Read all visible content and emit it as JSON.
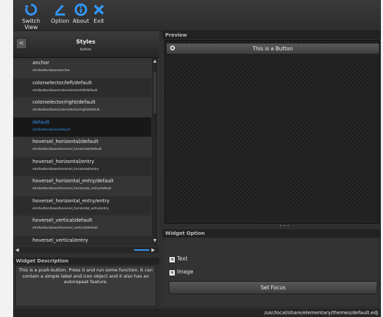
{
  "toolbar": {
    "items": [
      {
        "label": "Switch View",
        "icon": "refresh-icon"
      },
      {
        "label": "Option",
        "icon": "edit-icon"
      },
      {
        "label": "About",
        "icon": "info-icon"
      },
      {
        "label": "Exit",
        "icon": "close-icon"
      }
    ],
    "accent": "#3399ff"
  },
  "styles": {
    "back_label": "<",
    "title": "Styles",
    "subtitle": "button",
    "items": [
      {
        "name": "anchor",
        "path": "elm/button/base/anchor"
      },
      {
        "name": "colorselector/left/default",
        "path": "elm/button/base/colorselector/left/default"
      },
      {
        "name": "colorselector/right/default",
        "path": "elm/button/base/colorselector/right/default"
      },
      {
        "name": "default",
        "path": "elm/button/base/default"
      },
      {
        "name": "hoversel_horizontal/default",
        "path": "elm/button/base/hoversel_horizontal/default"
      },
      {
        "name": "hoversel_horizontal/entry",
        "path": "elm/button/base/hoversel_horizontal/entry"
      },
      {
        "name": "hoversel_horizontal_entry/default",
        "path": "elm/button/base/hoversel_horizontal_entry/default"
      },
      {
        "name": "hoversel_horizontal_entry/entry",
        "path": "elm/button/base/hoversel_horizontal_entry/entry"
      },
      {
        "name": "hoversel_vertical/default",
        "path": "elm/button/base/hoversel_vertical/default"
      },
      {
        "name": "hoversel_vertical/entry",
        "path": ""
      }
    ],
    "selected": "default"
  },
  "description": {
    "title": "Widget Description",
    "text": "This is a push-button. Press it and run some function. It can contain a simple label and icon object and it also has an autorepeat feature."
  },
  "preview": {
    "title": "Preview",
    "button_label": "This is a Button"
  },
  "widget_option": {
    "title": "Widget Option",
    "text_label": "Text",
    "image_label": "Image",
    "check_mark": "✕",
    "set_focus_label": "Set Focus"
  },
  "status": {
    "theme_path": "/usr/local/share/elementary/themes/default.edj"
  }
}
